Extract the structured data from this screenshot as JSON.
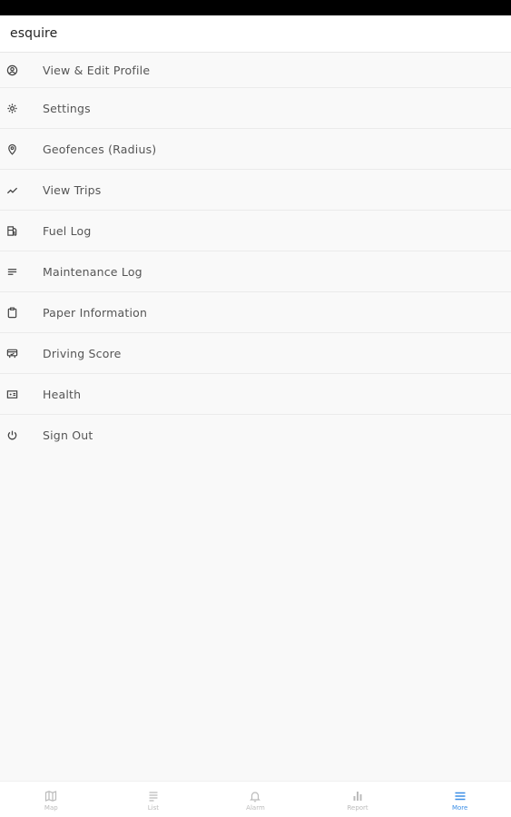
{
  "app": {
    "title": "esquire"
  },
  "menu": {
    "items": [
      {
        "label": "View & Edit Profile",
        "icon": "profile-icon"
      },
      {
        "label": "Settings",
        "icon": "gear-icon"
      },
      {
        "label": "Geofences (Radius)",
        "icon": "location-pin-icon"
      },
      {
        "label": "View Trips",
        "icon": "trending-icon"
      },
      {
        "label": "Fuel Log",
        "icon": "fuel-icon"
      },
      {
        "label": "Maintenance Log",
        "icon": "list-icon"
      },
      {
        "label": "Paper Information",
        "icon": "clipboard-icon"
      },
      {
        "label": "Driving Score",
        "icon": "score-icon"
      },
      {
        "label": "Health",
        "icon": "health-icon"
      },
      {
        "label": "Sign Out",
        "icon": "power-icon"
      }
    ]
  },
  "bottom_nav": {
    "items": [
      {
        "label": "Map",
        "icon": "map-icon",
        "active": false
      },
      {
        "label": "List",
        "icon": "list-icon",
        "active": false
      },
      {
        "label": "Alarm",
        "icon": "bell-icon",
        "active": false
      },
      {
        "label": "Report",
        "icon": "bar-chart-icon",
        "active": false
      },
      {
        "label": "More",
        "icon": "menu-icon",
        "active": true
      }
    ],
    "active_color": "#3a8ee6",
    "inactive_color": "#bbbbbb"
  }
}
